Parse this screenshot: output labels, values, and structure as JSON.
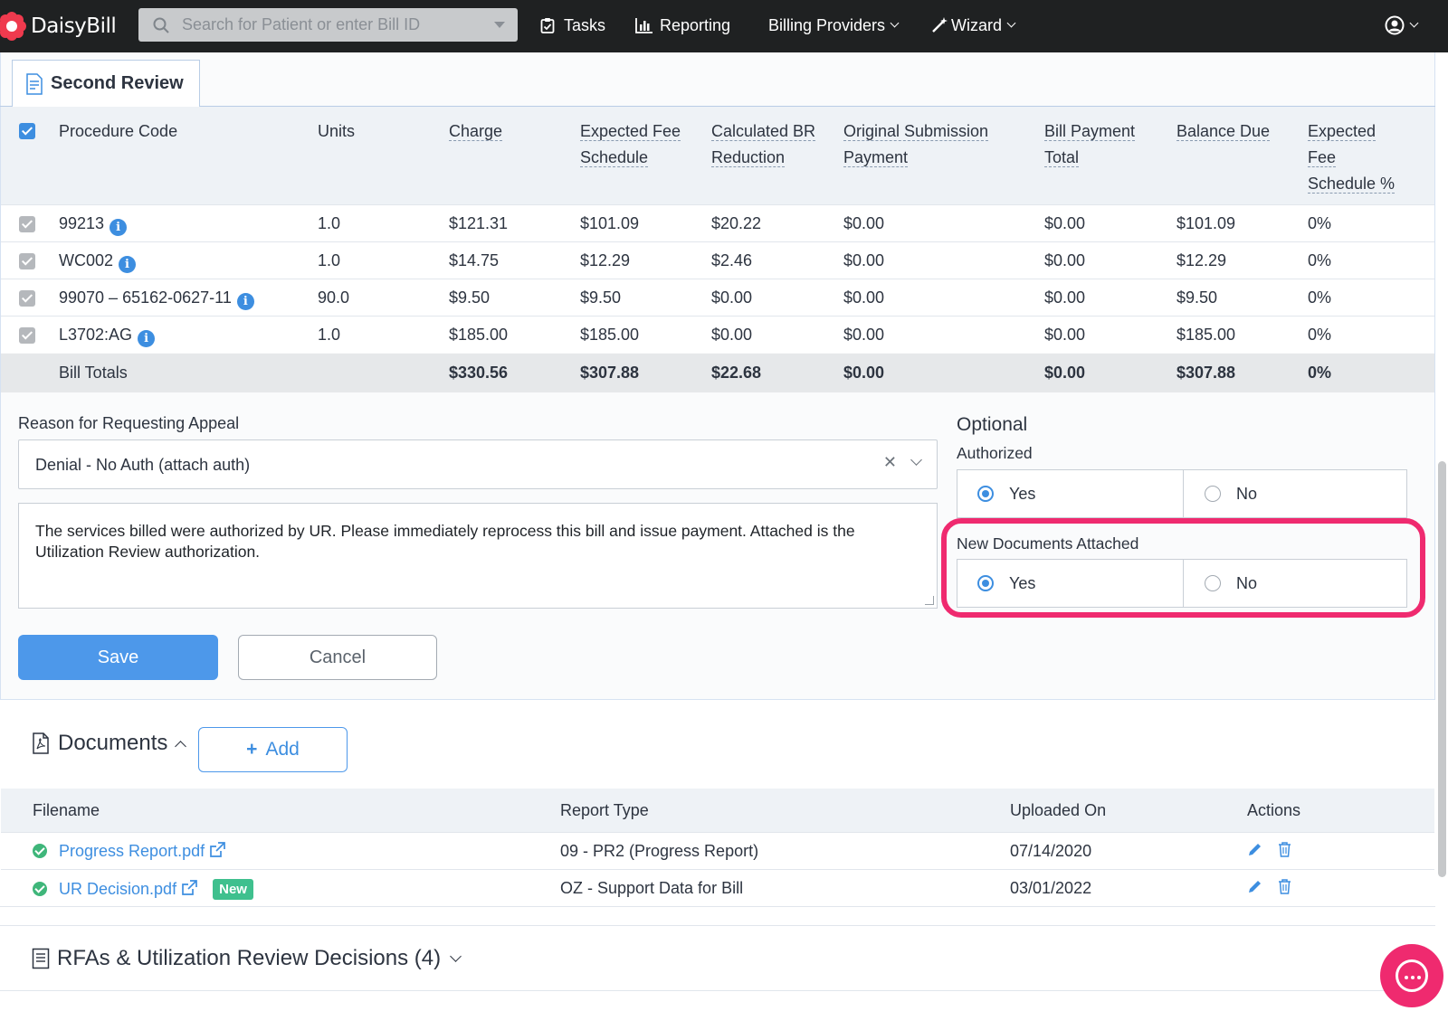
{
  "app": {
    "name": "DaisyBill"
  },
  "nav": {
    "search_placeholder": "Search for Patient or enter Bill ID",
    "tasks": "Tasks",
    "reporting": "Reporting",
    "billing_providers": "Billing Providers",
    "wizard": "Wizard"
  },
  "tab": {
    "label": "Second Review"
  },
  "procedures": {
    "headers": {
      "code": "Procedure Code",
      "units": "Units",
      "charge": "Charge",
      "fee_schedule_1": "Expected Fee",
      "fee_schedule_2": "Schedule",
      "br_1": "Calculated BR",
      "br_2": "Reduction",
      "orig_1": "Original Submission",
      "orig_2": "Payment",
      "bpt_1": "Bill Payment",
      "bpt_2": "Total",
      "balance": "Balance Due",
      "pct_1": "Expected",
      "pct_2": "Fee",
      "pct_3": "Schedule %"
    },
    "rows": [
      {
        "code": "99213",
        "units": "1.0",
        "charge": "$121.31",
        "fee": "$101.09",
        "br": "$20.22",
        "orig": "$0.00",
        "bpt": "$0.00",
        "balance": "$101.09",
        "pct": "0%"
      },
      {
        "code": "WC002",
        "units": "1.0",
        "charge": "$14.75",
        "fee": "$12.29",
        "br": "$2.46",
        "orig": "$0.00",
        "bpt": "$0.00",
        "balance": "$12.29",
        "pct": "0%"
      },
      {
        "code": "99070 – 65162-0627-11",
        "units": "90.0",
        "charge": "$9.50",
        "fee": "$9.50",
        "br": "$0.00",
        "orig": "$0.00",
        "bpt": "$0.00",
        "balance": "$9.50",
        "pct": "0%"
      },
      {
        "code": "L3702:AG",
        "units": "1.0",
        "charge": "$185.00",
        "fee": "$185.00",
        "br": "$0.00",
        "orig": "$0.00",
        "bpt": "$0.00",
        "balance": "$185.00",
        "pct": "0%"
      }
    ],
    "totals": {
      "label": "Bill Totals",
      "charge": "$330.56",
      "fee": "$307.88",
      "br": "$22.68",
      "orig": "$0.00",
      "bpt": "$0.00",
      "balance": "$307.88",
      "pct": "0%"
    }
  },
  "appeal": {
    "reason_label": "Reason for Requesting Appeal",
    "reason_value": "Denial - No Auth (attach auth)",
    "comment": "The services billed were authorized by UR. Please immediately reprocess this bill and issue payment. Attached is the Utilization Review authorization.",
    "save": "Save",
    "cancel": "Cancel"
  },
  "optional": {
    "title": "Optional",
    "authorized_label": "Authorized",
    "authorized_value": "Yes",
    "new_docs_label": "New Documents Attached",
    "new_docs_value": "Yes",
    "yes": "Yes",
    "no": "No"
  },
  "documents": {
    "title": "Documents",
    "add": "Add",
    "headers": {
      "filename": "Filename",
      "report_type": "Report Type",
      "uploaded_on": "Uploaded On",
      "actions": "Actions"
    },
    "rows": [
      {
        "filename": "Progress Report.pdf",
        "report_type": "09 - PR2 (Progress Report)",
        "uploaded_on": "07/14/2020",
        "badge": ""
      },
      {
        "filename": "UR Decision.pdf",
        "report_type": "OZ - Support Data for Bill",
        "uploaded_on": "03/01/2022",
        "badge": "New"
      }
    ]
  },
  "rfa": {
    "title": "RFAs & Utilization Review Decisions (4)"
  },
  "colors": {
    "nav_bg": "#1f2122",
    "accent": "#4d98ea",
    "highlight": "#ef2a6f",
    "success": "#3fb67a"
  }
}
